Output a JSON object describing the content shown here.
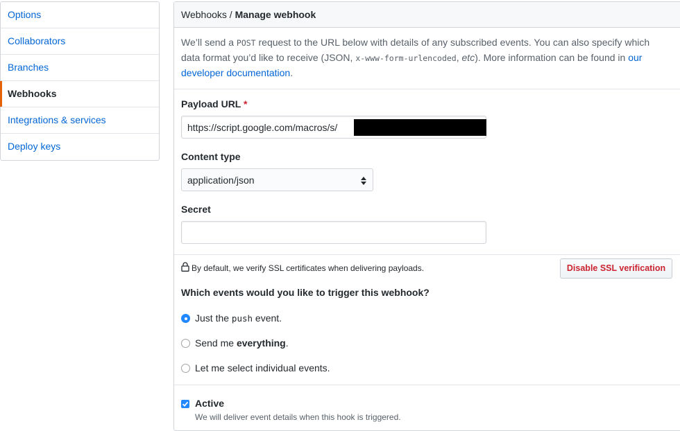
{
  "sidebar": {
    "items": [
      {
        "label": "Options"
      },
      {
        "label": "Collaborators"
      },
      {
        "label": "Branches"
      },
      {
        "label": "Webhooks"
      },
      {
        "label": "Integrations & services"
      },
      {
        "label": "Deploy keys"
      }
    ],
    "selected": "Webhooks"
  },
  "header": {
    "parent": "Webhooks",
    "separator": "/",
    "current": "Manage webhook"
  },
  "intro": {
    "part1": "We’ll send a ",
    "code1": "POST",
    "part2": " request to the URL below with details of any subscribed events. You can also specify which data format you’d like to receive (JSON, ",
    "code2": "x-www-form-urlencoded",
    "part3": ", ",
    "etc": "etc",
    "part4": "). More information can be found in ",
    "link": "our developer documentation",
    "part5": "."
  },
  "payload_url": {
    "label": "Payload URL",
    "required_mark": "*",
    "value": "https://script.google.com/macros/s/"
  },
  "content_type": {
    "label": "Content type",
    "value": "application/json"
  },
  "secret": {
    "label": "Secret",
    "value": ""
  },
  "ssl": {
    "note": "By default, we verify SSL certificates when delivering payloads.",
    "button": "Disable SSL verification"
  },
  "events": {
    "question": "Which events would you like to trigger this webhook?",
    "opt1_pre": "Just the ",
    "opt1_code": "push",
    "opt1_post": " event.",
    "opt2_pre": "Send me ",
    "opt2_bold": "everything",
    "opt2_post": ".",
    "opt3": "Let me select individual events.",
    "selected": "push"
  },
  "active": {
    "label": "Active",
    "checked": true,
    "note": "We will deliver event details when this hook is triggered."
  },
  "colors": {
    "link": "#0366d6",
    "selected_accent": "#e36209",
    "danger": "#cb2431",
    "primary": "#2188ff"
  },
  "icons": {
    "lock": "lock-icon",
    "select_arrows": "select-arrows-icon",
    "checkmark": "checkmark-icon"
  }
}
